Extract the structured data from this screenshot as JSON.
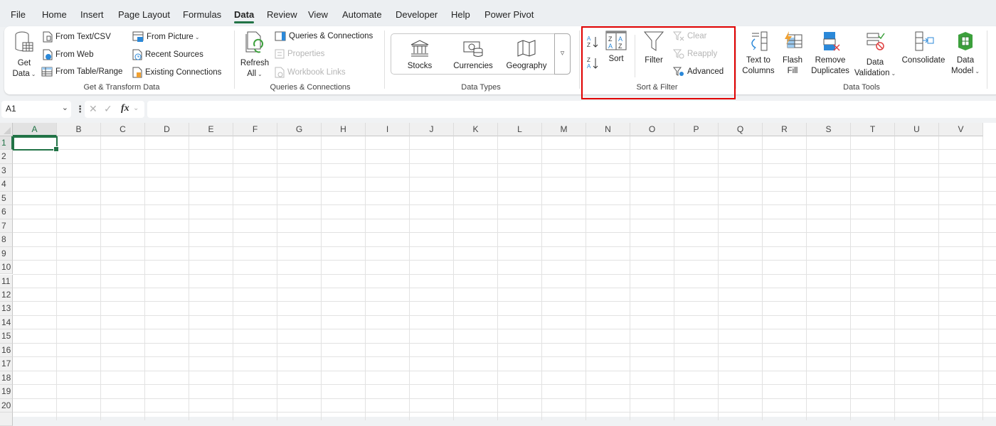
{
  "menu": {
    "tabs": [
      {
        "label": "File"
      },
      {
        "label": "Home"
      },
      {
        "label": "Insert"
      },
      {
        "label": "Page Layout"
      },
      {
        "label": "Formulas"
      },
      {
        "label": "Data",
        "active": true
      },
      {
        "label": "Review"
      },
      {
        "label": "View"
      },
      {
        "label": "Automate"
      },
      {
        "label": "Developer"
      },
      {
        "label": "Help"
      },
      {
        "label": "Power Pivot"
      }
    ]
  },
  "ribbon": {
    "get_transform": {
      "label": "Get & Transform Data",
      "get_data_line1": "Get",
      "get_data_line2": "Data",
      "from_text_csv": "From Text/CSV",
      "from_web": "From Web",
      "from_table_range": "From Table/Range",
      "from_picture": "From Picture",
      "recent_sources": "Recent Sources",
      "existing_connections": "Existing Connections"
    },
    "queries": {
      "label": "Queries & Connections",
      "refresh_line1": "Refresh",
      "refresh_line2": "All",
      "queries_connections": "Queries & Connections",
      "properties": "Properties",
      "workbook_links": "Workbook Links"
    },
    "data_types": {
      "label": "Data Types",
      "stocks": "Stocks",
      "currencies": "Currencies",
      "geography": "Geography"
    },
    "sort_filter": {
      "label": "Sort & Filter",
      "sort": "Sort",
      "filter": "Filter",
      "clear": "Clear",
      "reapply": "Reapply",
      "advanced": "Advanced"
    },
    "data_tools": {
      "label": "Data Tools",
      "text_to_columns_1": "Text to",
      "text_to_columns_2": "Columns",
      "flash_fill_1": "Flash",
      "flash_fill_2": "Fill",
      "remove_duplicates_1": "Remove",
      "remove_duplicates_2": "Duplicates",
      "data_validation_1": "Data",
      "data_validation_2": "Validation",
      "consolidate": "Consolidate",
      "data_model_1": "Data",
      "data_model_2": "Model"
    }
  },
  "formula_bar": {
    "name_box": "A1",
    "fx": "fx",
    "formula": ""
  },
  "sheet": {
    "columns": [
      "A",
      "B",
      "C",
      "D",
      "E",
      "F",
      "G",
      "H",
      "I",
      "J",
      "K",
      "L",
      "M",
      "N",
      "O",
      "P",
      "Q",
      "R",
      "S",
      "T",
      "U",
      "V"
    ],
    "rows": [
      "1",
      "2",
      "3",
      "4",
      "5",
      "6",
      "7",
      "8",
      "9",
      "10",
      "11",
      "12",
      "13",
      "14",
      "15",
      "16",
      "17",
      "18",
      "19",
      "20"
    ],
    "active_cell": "A1"
  },
  "colors": {
    "accent": "#217346",
    "highlight": "#e00000"
  }
}
